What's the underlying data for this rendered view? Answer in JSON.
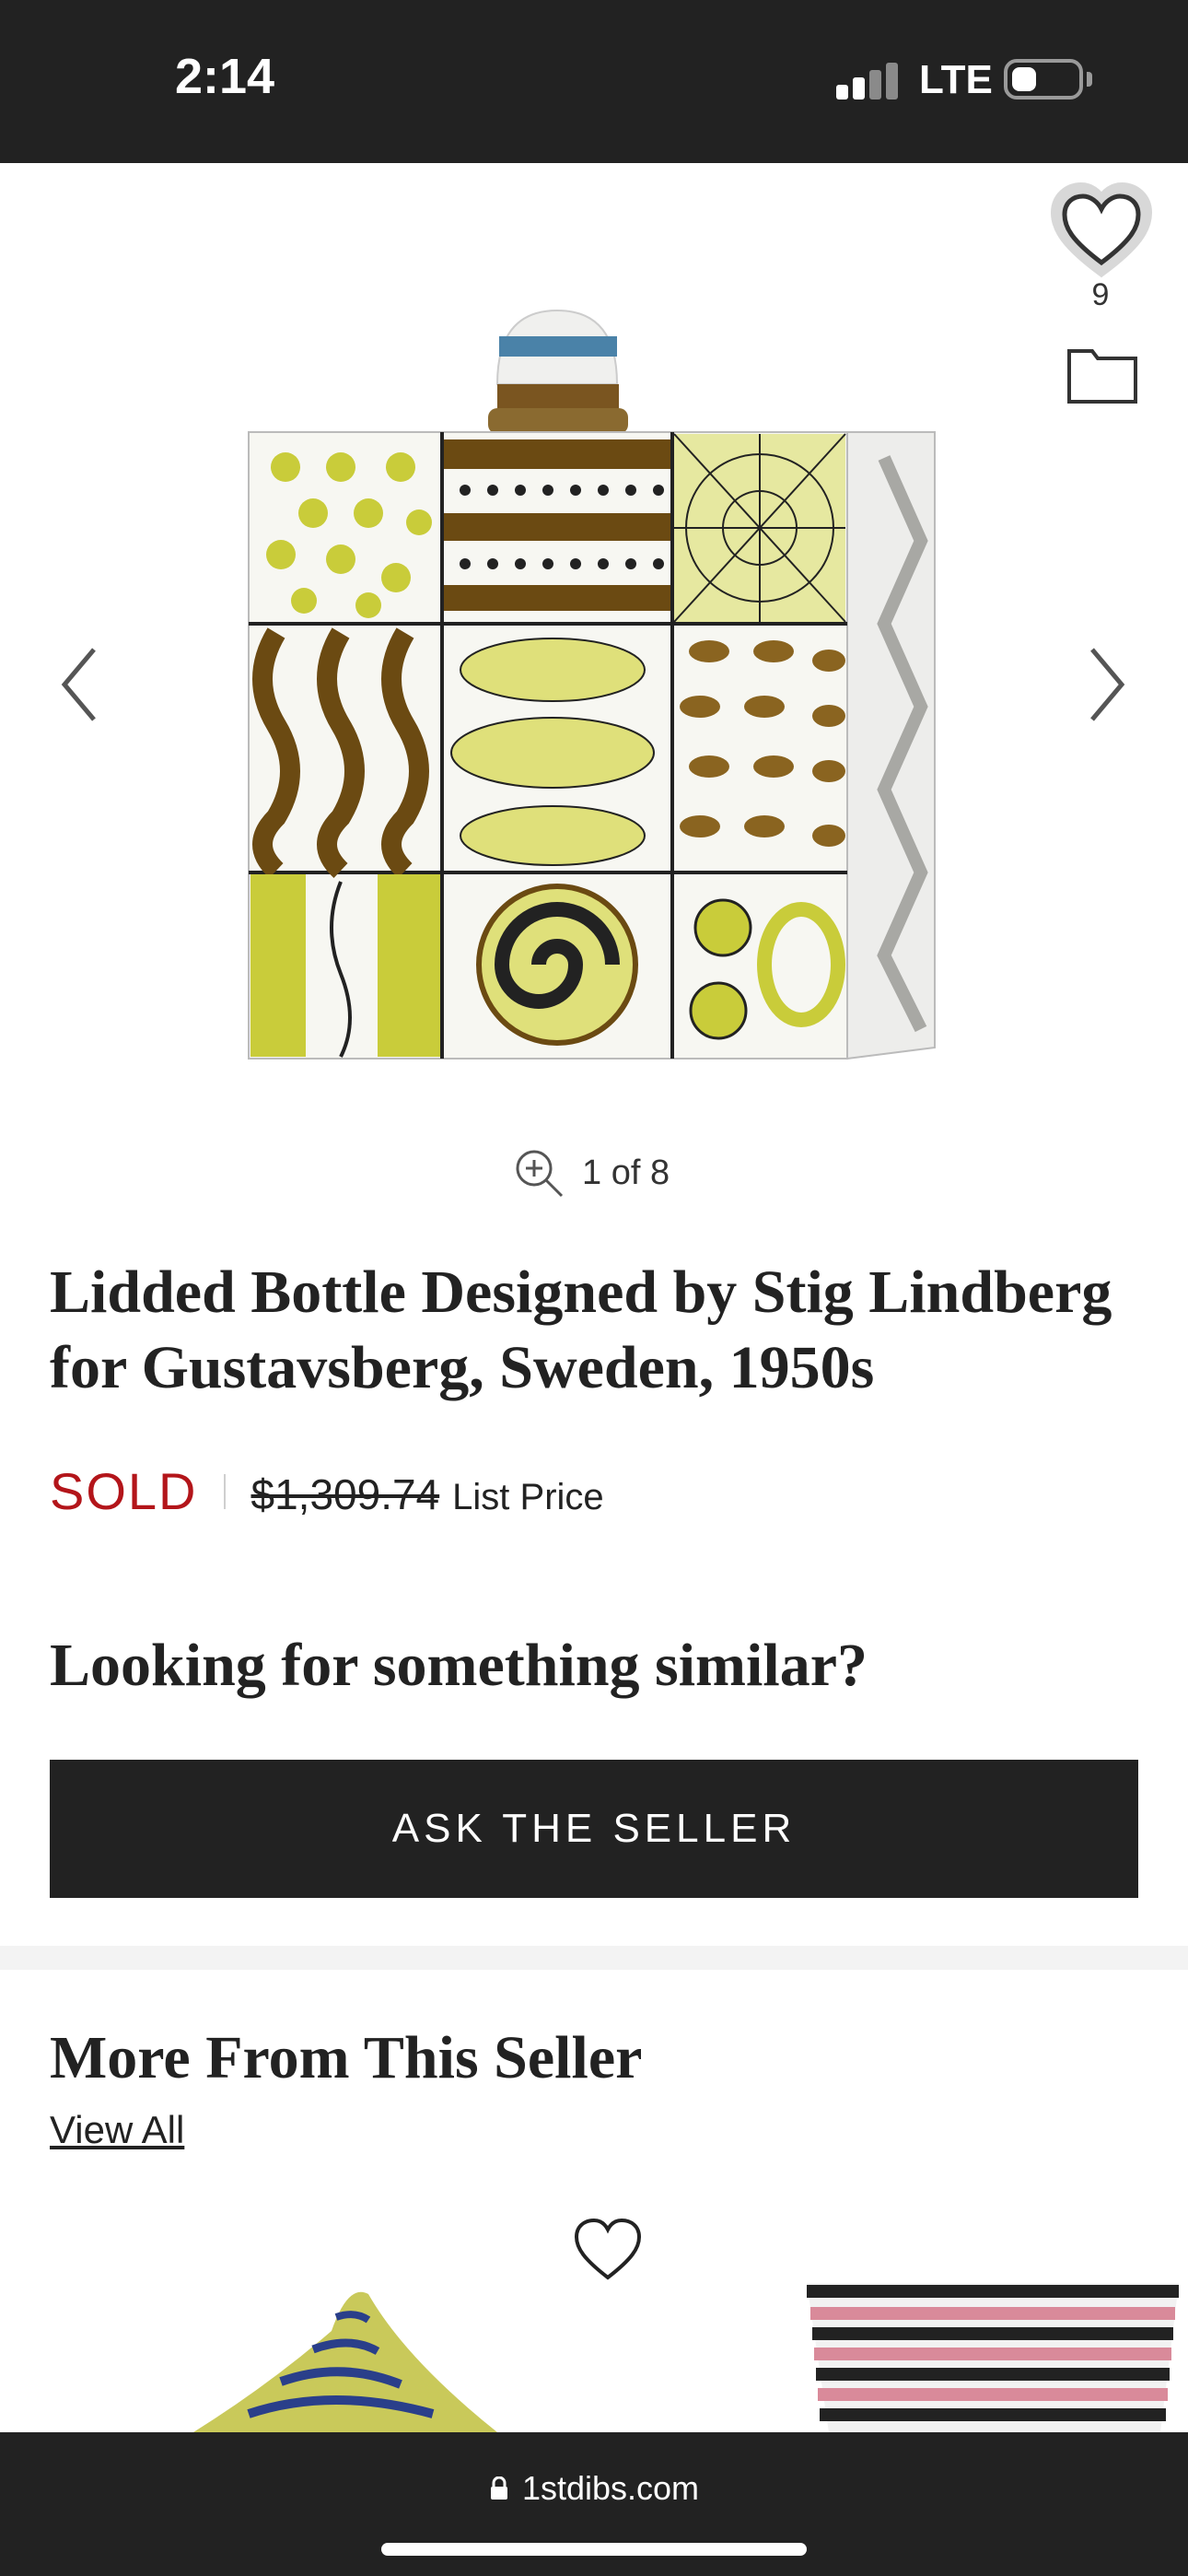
{
  "status_bar": {
    "time": "2:14",
    "network": "LTE"
  },
  "gallery": {
    "counter": "1 of 8",
    "favorites_count": "9"
  },
  "product": {
    "title": "Lidded Bottle Designed by Stig Lindberg for Gustavsberg, Sweden, 1950s",
    "status": "SOLD",
    "list_price": "$1,309.74",
    "list_price_label": "List Price"
  },
  "similar": {
    "heading": "Looking for something similar?",
    "button_label": "ASK THE SELLER"
  },
  "more_from_seller": {
    "heading": "More From This Seller",
    "view_all_label": "View All"
  },
  "browser": {
    "url": "1stdibs.com"
  },
  "colors": {
    "dark_bar": "#222222",
    "sold_red": "#b3151a",
    "divider": "#f3f3f3"
  },
  "icons": [
    "signal-icon",
    "battery-icon",
    "heart-icon",
    "folder-icon",
    "chevron-left-icon",
    "chevron-right-icon",
    "zoom-icon",
    "lock-icon"
  ]
}
